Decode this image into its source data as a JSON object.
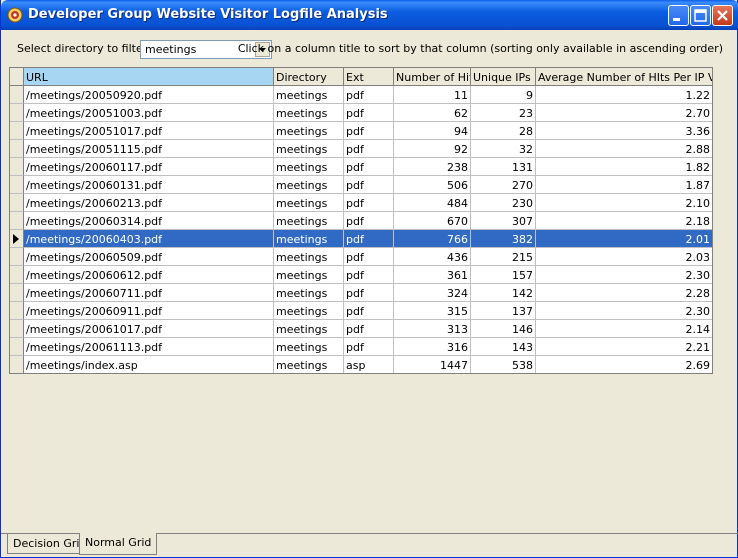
{
  "window": {
    "title": "Developer Group Website Visitor Logfile Analysis",
    "accent": "#0a52d3"
  },
  "filter": {
    "label": "Select directory to filter:",
    "selected": "meetings"
  },
  "hint": "Click on a column title to sort by that column (sorting only available in ascending order)",
  "columns": {
    "url": "URL",
    "directory": "Directory",
    "ext": "Ext",
    "hits": "Number of Hits",
    "ips": "Unique IPs",
    "avg": "Average Number of HIts Per IP Visit"
  },
  "rows": [
    {
      "url": "/meetings/20050920.pdf",
      "dir": "meetings",
      "ext": "pdf",
      "hits": "11",
      "ips": "9",
      "avg": "1.22"
    },
    {
      "url": "/meetings/20051003.pdf",
      "dir": "meetings",
      "ext": "pdf",
      "hits": "62",
      "ips": "23",
      "avg": "2.70"
    },
    {
      "url": "/meetings/20051017.pdf",
      "dir": "meetings",
      "ext": "pdf",
      "hits": "94",
      "ips": "28",
      "avg": "3.36"
    },
    {
      "url": "/meetings/20051115.pdf",
      "dir": "meetings",
      "ext": "pdf",
      "hits": "92",
      "ips": "32",
      "avg": "2.88"
    },
    {
      "url": "/meetings/20060117.pdf",
      "dir": "meetings",
      "ext": "pdf",
      "hits": "238",
      "ips": "131",
      "avg": "1.82"
    },
    {
      "url": "/meetings/20060131.pdf",
      "dir": "meetings",
      "ext": "pdf",
      "hits": "506",
      "ips": "270",
      "avg": "1.87"
    },
    {
      "url": "/meetings/20060213.pdf",
      "dir": "meetings",
      "ext": "pdf",
      "hits": "484",
      "ips": "230",
      "avg": "2.10"
    },
    {
      "url": "/meetings/20060314.pdf",
      "dir": "meetings",
      "ext": "pdf",
      "hits": "670",
      "ips": "307",
      "avg": "2.18"
    },
    {
      "url": "/meetings/20060403.pdf",
      "dir": "meetings",
      "ext": "pdf",
      "hits": "766",
      "ips": "382",
      "avg": "2.01"
    },
    {
      "url": "/meetings/20060509.pdf",
      "dir": "meetings",
      "ext": "pdf",
      "hits": "436",
      "ips": "215",
      "avg": "2.03"
    },
    {
      "url": "/meetings/20060612.pdf",
      "dir": "meetings",
      "ext": "pdf",
      "hits": "361",
      "ips": "157",
      "avg": "2.30"
    },
    {
      "url": "/meetings/20060711.pdf",
      "dir": "meetings",
      "ext": "pdf",
      "hits": "324",
      "ips": "142",
      "avg": "2.28"
    },
    {
      "url": "/meetings/20060911.pdf",
      "dir": "meetings",
      "ext": "pdf",
      "hits": "315",
      "ips": "137",
      "avg": "2.30"
    },
    {
      "url": "/meetings/20061017.pdf",
      "dir": "meetings",
      "ext": "pdf",
      "hits": "313",
      "ips": "146",
      "avg": "2.14"
    },
    {
      "url": "/meetings/20061113.pdf",
      "dir": "meetings",
      "ext": "pdf",
      "hits": "316",
      "ips": "143",
      "avg": "2.21"
    },
    {
      "url": "/meetings/index.asp",
      "dir": "meetings",
      "ext": "asp",
      "hits": "1447",
      "ips": "538",
      "avg": "2.69"
    }
  ],
  "selected_row": 8,
  "tabs": [
    "Decision Grid",
    "Normal Grid"
  ],
  "active_tab": 1
}
